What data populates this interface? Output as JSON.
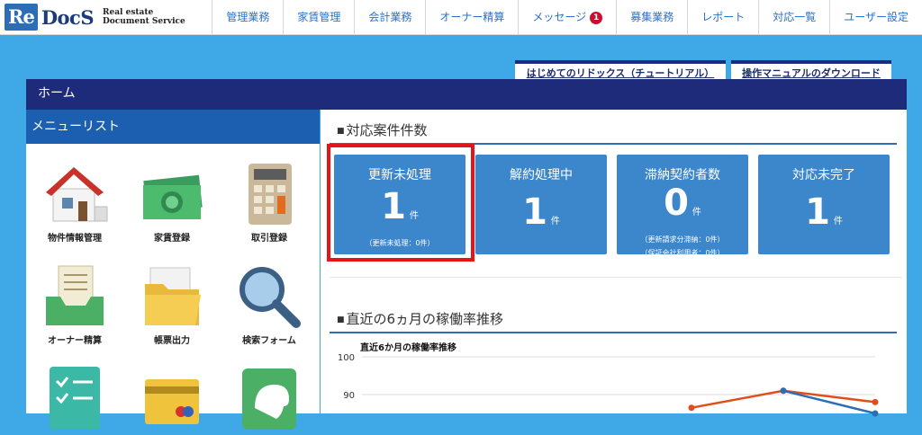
{
  "app": {
    "logo_re": "Re",
    "logo_docs": "DocS",
    "logo_sub1": "Real estate",
    "logo_sub2": "Document Service"
  },
  "nav": {
    "items": [
      {
        "label": "管理業務"
      },
      {
        "label": "家賃管理"
      },
      {
        "label": "会計業務"
      },
      {
        "label": "オーナー精算"
      },
      {
        "label": "メッセージ",
        "badge": "1"
      },
      {
        "label": "募集業務"
      },
      {
        "label": "レポート"
      },
      {
        "label": "対応一覧"
      },
      {
        "label": "ユーザー設定"
      }
    ]
  },
  "tabs": {
    "tutorial": "はじめてのリドックス（チュートリアル）",
    "manual": "操作マニュアルのダウンロード"
  },
  "home": {
    "title": "ホーム"
  },
  "menu": {
    "title": "メニューリスト",
    "items": [
      {
        "label": "物件情報管理",
        "icon": "house-icon"
      },
      {
        "label": "家賃登録",
        "icon": "money-icon"
      },
      {
        "label": "取引登録",
        "icon": "calculator-icon"
      },
      {
        "label": "オーナー精算",
        "icon": "tray-document-icon"
      },
      {
        "label": "帳票出力",
        "icon": "folder-icon"
      },
      {
        "label": "検索フォーム",
        "icon": "magnifier-icon"
      },
      {
        "label": "",
        "icon": "checklist-icon"
      },
      {
        "label": "",
        "icon": "card-icon"
      },
      {
        "label": "",
        "icon": "elephant-icon"
      }
    ]
  },
  "cases": {
    "title": "対応案件件数",
    "cards": [
      {
        "title": "更新未処理",
        "count": "1",
        "unit": "件",
        "sub1": "（更新未処理：0件）",
        "sub2": ""
      },
      {
        "title": "解約処理中",
        "count": "1",
        "unit": "件",
        "sub1": "",
        "sub2": ""
      },
      {
        "title": "滞納契約者数",
        "count": "0",
        "unit": "件",
        "sub1": "（更新請求分滞納：0件）",
        "sub2": "（保証会社利用者：0件）"
      },
      {
        "title": "対応未完了",
        "count": "1",
        "unit": "件",
        "sub1": "",
        "sub2": ""
      }
    ]
  },
  "trend": {
    "title": "直近の6ヵ月の稼働率推移"
  },
  "chart_data": {
    "type": "line",
    "title": "直近6か月の稼働率推移",
    "yticks": [
      100,
      90
    ],
    "ylim": [
      85,
      100
    ],
    "series": [
      {
        "color": "#e04e1c",
        "values": [
          null,
          null,
          null,
          86.5,
          91,
          88
        ]
      },
      {
        "color": "#2c6db5",
        "values": [
          null,
          null,
          null,
          null,
          91,
          85
        ]
      }
    ],
    "colors": {
      "grid": "#dddddd"
    }
  },
  "colors": {
    "accent": "#3c86cc",
    "navy": "#1e2b7a",
    "highlight": "#e3141a",
    "background": "#3fa9e8"
  }
}
